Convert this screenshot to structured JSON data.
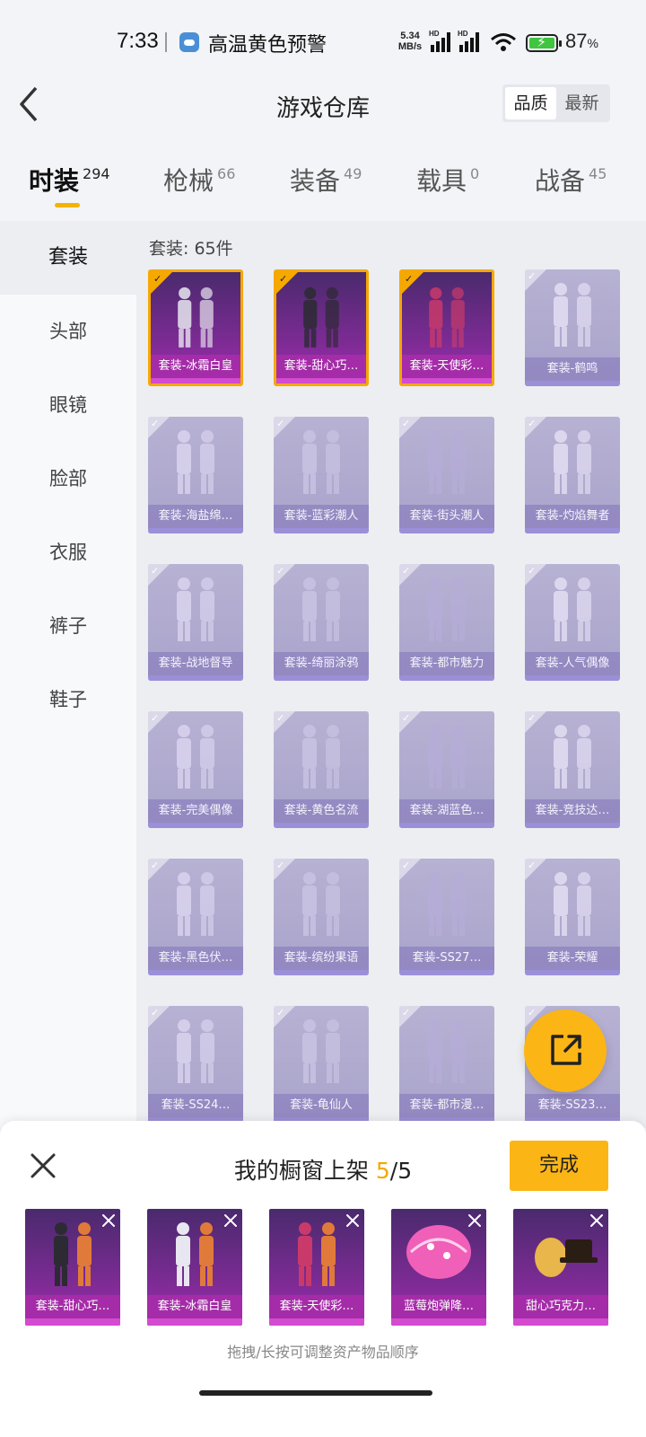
{
  "status_bar": {
    "time": "7:33",
    "alert": "高温黄色预警",
    "net_speed": "5.34",
    "net_unit": "MB/s",
    "hd1": "HD",
    "hd2": "HD",
    "battery": "87",
    "battery_unit": "%"
  },
  "header": {
    "title": "游戏仓库",
    "sort_options": [
      "品质",
      "最新"
    ],
    "sort_selected": "品质"
  },
  "tabs": [
    {
      "label": "时装",
      "count": "294",
      "active": true
    },
    {
      "label": "枪械",
      "count": "66"
    },
    {
      "label": "装备",
      "count": "49"
    },
    {
      "label": "载具",
      "count": "0"
    },
    {
      "label": "战备",
      "count": "45"
    }
  ],
  "sidebar": {
    "items": [
      "套装",
      "头部",
      "眼镜",
      "脸部",
      "衣服",
      "裤子",
      "鞋子"
    ],
    "active": "套装"
  },
  "grid": {
    "count_label": "套装: 65件",
    "items": [
      {
        "name": "套装-冰霜白皇",
        "selected": true
      },
      {
        "name": "套装-甜心巧…",
        "selected": true
      },
      {
        "name": "套装-天使彩…",
        "selected": true
      },
      {
        "name": "套装-鹤鸣",
        "selected": false
      },
      {
        "name": "套装-海盐绵…",
        "selected": false
      },
      {
        "name": "套装-蓝彩潮人",
        "selected": false
      },
      {
        "name": "套装-街头潮人",
        "selected": false
      },
      {
        "name": "套装-灼焰舞者",
        "selected": false
      },
      {
        "name": "套装-战地督导",
        "selected": false
      },
      {
        "name": "套装-绮丽涂鸦",
        "selected": false
      },
      {
        "name": "套装-都市魅力",
        "selected": false
      },
      {
        "name": "套装-人气偶像",
        "selected": false
      },
      {
        "name": "套装-完美偶像",
        "selected": false
      },
      {
        "name": "套装-黄色名流",
        "selected": false
      },
      {
        "name": "套装-湖蓝色…",
        "selected": false
      },
      {
        "name": "套装-竞技达…",
        "selected": false
      },
      {
        "name": "套装-黑色伏…",
        "selected": false
      },
      {
        "name": "套装-缤纷果语",
        "selected": false
      },
      {
        "name": "套装-SS27…",
        "selected": false
      },
      {
        "name": "套装-荣耀",
        "selected": false
      },
      {
        "name": "套装-SS24…",
        "selected": false
      },
      {
        "name": "套装-龟仙人",
        "selected": false
      },
      {
        "name": "套装-都市漫…",
        "selected": false
      },
      {
        "name": "套装-SS23…",
        "selected": false
      }
    ]
  },
  "showcase": {
    "title_prefix": "我的橱窗上架 ",
    "current": "5",
    "separator": "/",
    "total": "5",
    "done_label": "完成",
    "items": [
      "套装-甜心巧…",
      "套装-冰霜白皇",
      "套装-天使彩…",
      "蓝莓炮弹降…",
      "甜心巧克力…"
    ],
    "hint": "拖拽/长按可调整资产物品顺序"
  },
  "colors": {
    "accent": "#fbb515",
    "selected_border": "#f5a800",
    "purple_card": "#a52ca8",
    "dim_card": "#aba5cc"
  }
}
